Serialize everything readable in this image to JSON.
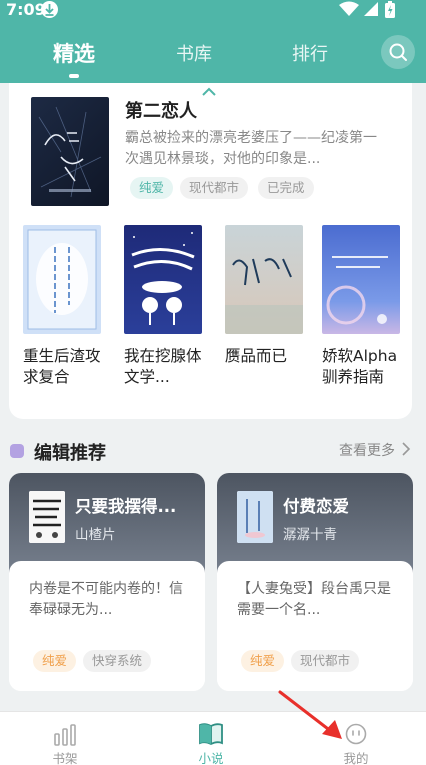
{
  "status_bar": {
    "time": "7:09"
  },
  "header": {
    "tabs": [
      {
        "label": "精选",
        "active": true
      },
      {
        "label": "书库",
        "active": false
      },
      {
        "label": "排行",
        "active": false
      }
    ],
    "search_icon": "search-icon"
  },
  "featured": {
    "title": "第二恋人",
    "description": "霸总被捡来的漂亮老婆压了——纪凌第一次遇见林景琰，对他的印象是...",
    "tags": [
      "纯爱",
      "现代都市",
      "已完成"
    ],
    "cover_text": "第二恋人"
  },
  "books": [
    {
      "title": "重生后渣攻求复合",
      "cover_text": "重生后渣攻求复合"
    },
    {
      "title": "我在挖腺体文学...",
      "cover_text": "我在挖腺体文学"
    },
    {
      "title": "赝品而已",
      "cover_text": "赝品而已"
    },
    {
      "title": "娇软Alpha驯养指南",
      "cover_text": "娇软ALPHA驯养指南"
    }
  ],
  "editor_section": {
    "title": "编辑推荐",
    "more": "查看更多",
    "cards": [
      {
        "title": "只要我摆得...",
        "author": "山楂片",
        "description": "内卷是不可能内卷的！信奉碌碌无为...",
        "tags": [
          "纯爱",
          "快穿系统"
        ]
      },
      {
        "title": "付费恋爱",
        "author": "潺潺十青",
        "description": "【人妻兔受】段台禹只是需要一个名...",
        "tags": [
          "纯爱",
          "现代都市"
        ]
      }
    ]
  },
  "bottom_nav": [
    {
      "label": "书架",
      "icon": "bookshelf-icon",
      "active": false
    },
    {
      "label": "小说",
      "icon": "book-open-icon",
      "active": true
    },
    {
      "label": "我的",
      "icon": "profile-icon",
      "active": false
    }
  ],
  "colors": {
    "accent": "#4fb6a8",
    "tag_orange": "#f0a04b",
    "annotation_arrow": "#e8302b"
  }
}
